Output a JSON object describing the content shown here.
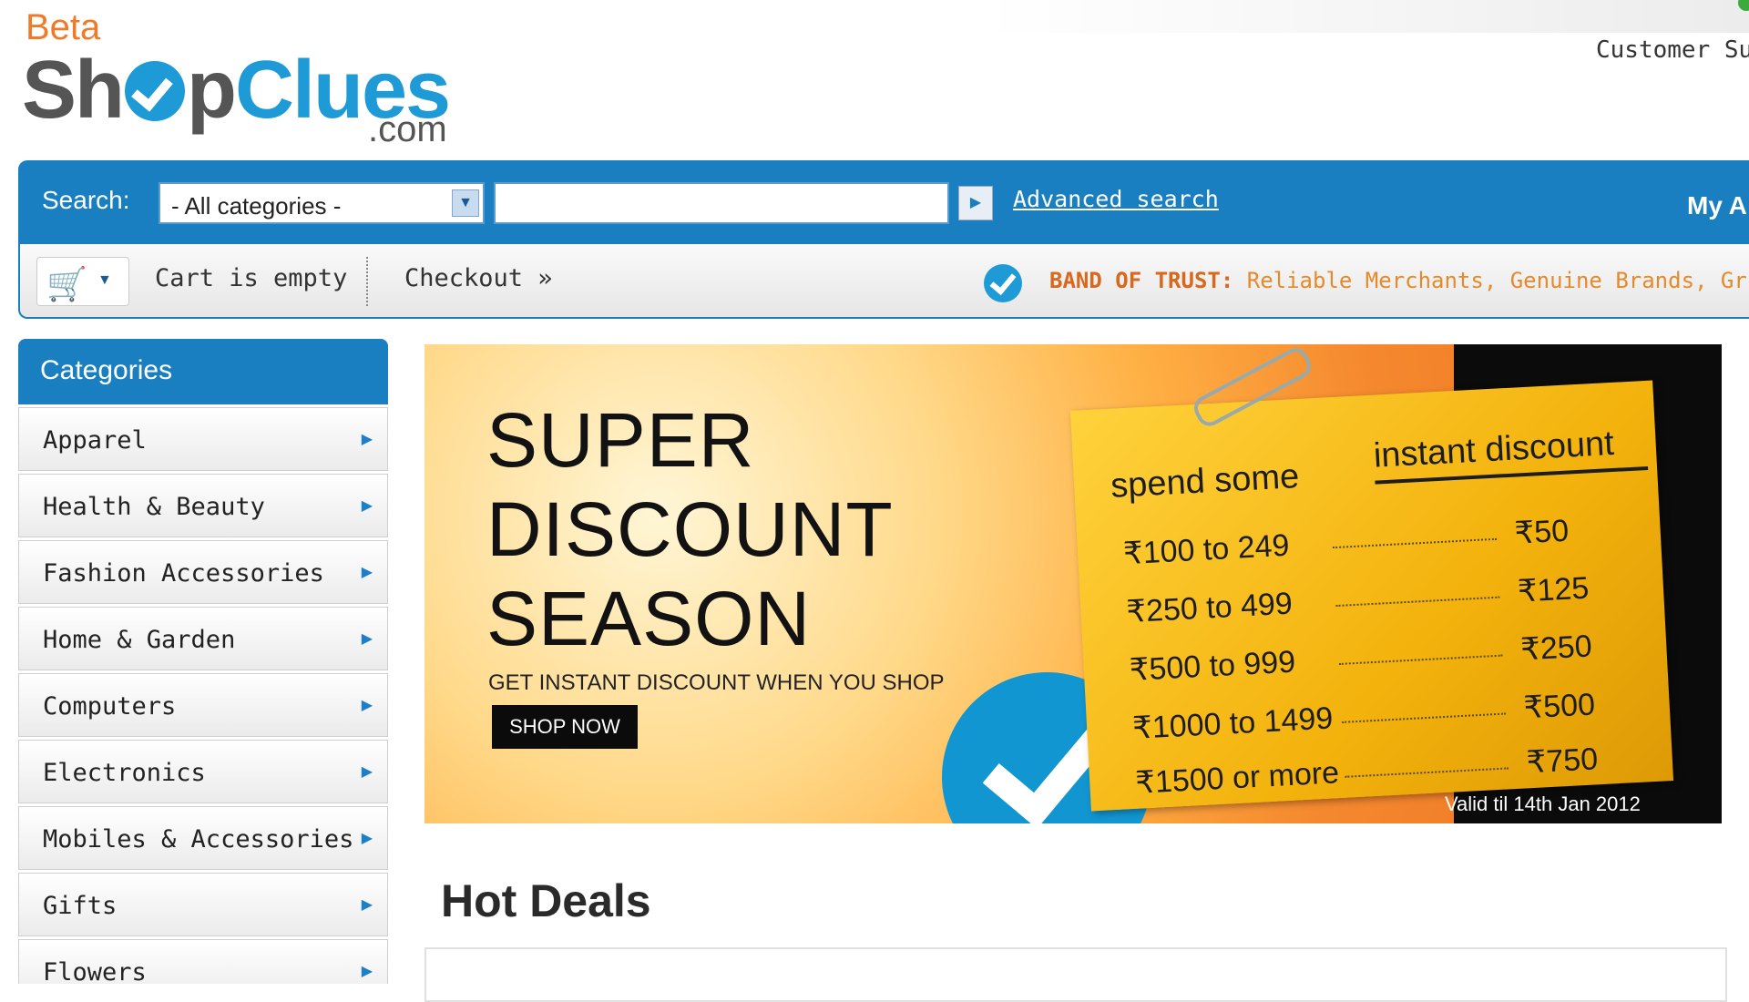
{
  "header": {
    "logo_beta": "Beta",
    "logo_sh": "Sh",
    "logo_p": "p",
    "logo_clues": "Clues",
    "logo_com": ".com",
    "customer_support": "Customer Su"
  },
  "search": {
    "label": "Search:",
    "category_selected": "- All categories -",
    "input_value": "",
    "advanced_label": "Advanced search",
    "my_account_label": "My A"
  },
  "cart": {
    "status": "Cart is empty",
    "checkout_label": "Checkout »",
    "trust_title": "BAND OF TRUST:",
    "trust_text": " Reliable Merchants, Genuine Brands, Gr"
  },
  "sidebar": {
    "title": "Categories",
    "items": [
      {
        "label": "Apparel"
      },
      {
        "label": "Health & Beauty"
      },
      {
        "label": "Fashion Accessories"
      },
      {
        "label": "Home & Garden"
      },
      {
        "label": "Computers"
      },
      {
        "label": "Electronics"
      },
      {
        "label": "Mobiles & Accessories"
      },
      {
        "label": "Gifts"
      },
      {
        "label": "Flowers"
      }
    ]
  },
  "banner": {
    "title_line1": "SUPER",
    "title_line2": "DISCOUNT",
    "title_line3": "SEASON",
    "subtitle": "GET INSTANT DISCOUNT WHEN YOU SHOP",
    "cta_label": "SHOP NOW",
    "card_head_left": "spend some",
    "card_head_right": "instant discount",
    "rows": [
      {
        "range": "₹100 to 249",
        "discount": "₹50"
      },
      {
        "range": "₹250 to 499",
        "discount": "₹125"
      },
      {
        "range": "₹500 to 999",
        "discount": "₹250"
      },
      {
        "range": "₹1000 to 1499",
        "discount": "₹500"
      },
      {
        "range": "₹1500 or more",
        "discount": "₹750"
      }
    ],
    "valid_text": "Valid til 14th Jan 2012"
  },
  "hot_deals": {
    "title": "Hot Deals"
  },
  "colors": {
    "brand_blue": "#1a7fc0",
    "brand_orange": "#f07a25",
    "card_yellow": "#f3b20c"
  }
}
